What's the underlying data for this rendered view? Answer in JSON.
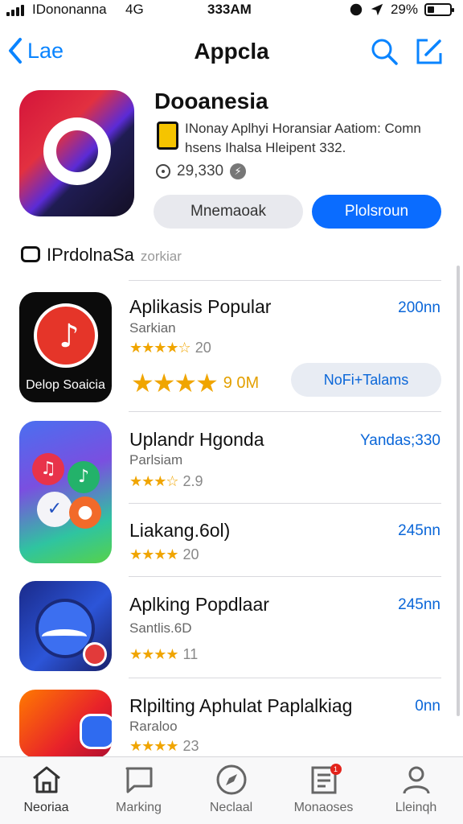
{
  "status_bar": {
    "carrier": "IDononanna",
    "network": "4G",
    "time": "333AM",
    "battery": "29%",
    "battery_level": 0.29
  },
  "nav": {
    "back_label": "Lae",
    "title": "Appcla"
  },
  "featured": {
    "title": "Dooanesia",
    "description": "INonay Aplhyi Horansiar Aatiom: Comn hsens Ihalsa Hleipent 332.",
    "count": "29,330",
    "secondary_button": "Mnemaoak",
    "primary_button": "Plolsroun"
  },
  "section": {
    "title": "IPrdolnaSa",
    "subtitle": "zorkiar"
  },
  "apps": [
    {
      "name": "Aplikasis Popular",
      "subtitle": "Sarkian",
      "stars": "★★★★☆",
      "rating": "20",
      "size": "200nn",
      "icon_label": "Delop Soaicia",
      "big_stars": "★★★★",
      "big_count": "9 0M",
      "action_button": "NoFi+Talams"
    },
    {
      "name": "Uplandr Hgonda",
      "subtitle": "Parlsiam",
      "stars": "★★★☆",
      "rating": "2.9",
      "size": "Yandas;330"
    },
    {
      "name": "Liakang.6ol)",
      "subtitle": "",
      "stars": "★★★★",
      "rating": "20",
      "size": "245nn"
    },
    {
      "name": "Aplking Popdlaar",
      "subtitle": "Santlis.6D",
      "stars": "★★★★",
      "rating": "11",
      "size": "245nn"
    },
    {
      "name": "Rlpilting Aphulat Paplalkiag",
      "subtitle": "Raraloo",
      "stars": "★★★★",
      "rating": "23",
      "size": "0nn"
    }
  ],
  "tabs": [
    {
      "label": "Neoriaa",
      "icon": "home-icon"
    },
    {
      "label": "Marking",
      "icon": "chat-flag-icon"
    },
    {
      "label": "Neclaal",
      "icon": "compass-icon"
    },
    {
      "label": "Monaoses",
      "icon": "document-icon",
      "badge": "1"
    },
    {
      "label": "Lleinqh",
      "icon": "person-icon"
    }
  ],
  "colors": {
    "accent": "#0a6cff",
    "star": "#f0a500"
  }
}
